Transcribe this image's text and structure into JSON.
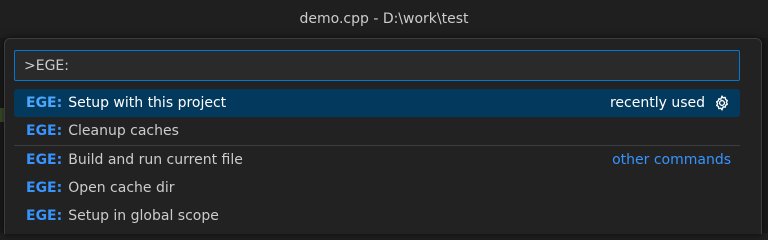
{
  "window": {
    "title": "demo.cpp - D:\\work\\test"
  },
  "palette": {
    "input_value": ">EGE:",
    "recently_used_label": "recently used",
    "other_commands_label": "other commands",
    "items": [
      {
        "prefix": "EGE:",
        "label": "Setup with this project"
      },
      {
        "prefix": "EGE:",
        "label": "Cleanup caches"
      },
      {
        "prefix": "EGE:",
        "label": "Build and run current file"
      },
      {
        "prefix": "EGE:",
        "label": "Open cache dir"
      },
      {
        "prefix": "EGE:",
        "label": "Setup in global scope"
      }
    ]
  },
  "colors": {
    "accent": "#0078d4",
    "selection": "#04395e",
    "prefix": "#3794ff",
    "link": "#3794ff"
  },
  "icons": {
    "configure": "gear-icon"
  }
}
